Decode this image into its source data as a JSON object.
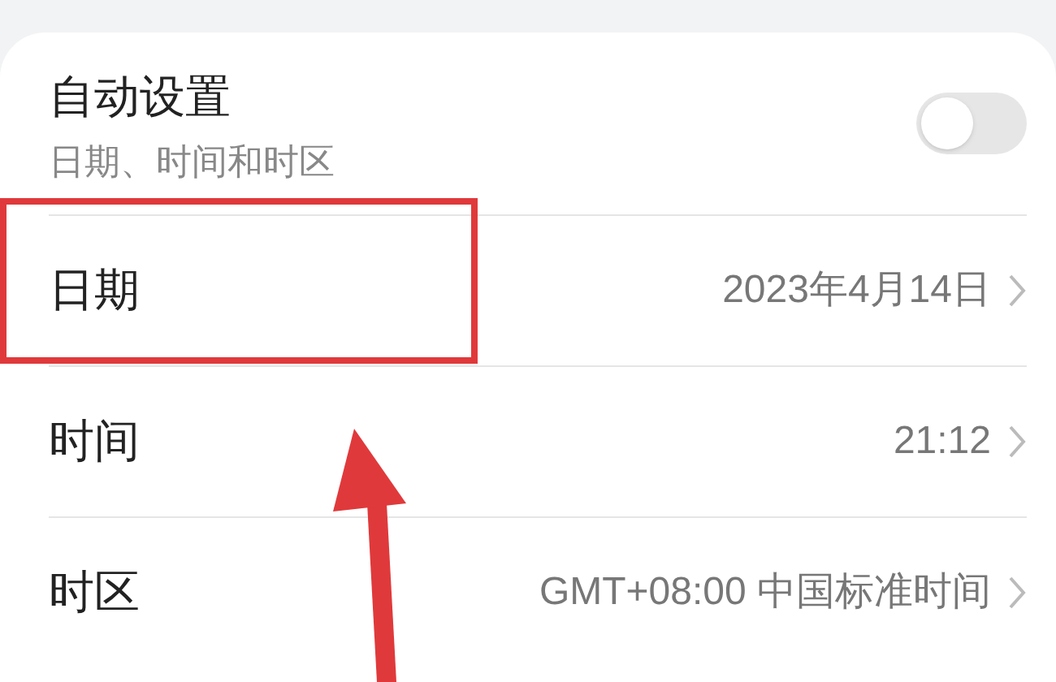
{
  "auto_setting": {
    "title": "自动设置",
    "subtitle": "日期、时间和时区",
    "on": false
  },
  "rows": [
    {
      "label": "日期",
      "value": "2023年4月14日",
      "highlighted": true
    },
    {
      "label": "时间",
      "value": "21:12",
      "highlighted": false
    },
    {
      "label": "时区",
      "value": "GMT+08:00 中国标准时间",
      "highlighted": false
    }
  ]
}
